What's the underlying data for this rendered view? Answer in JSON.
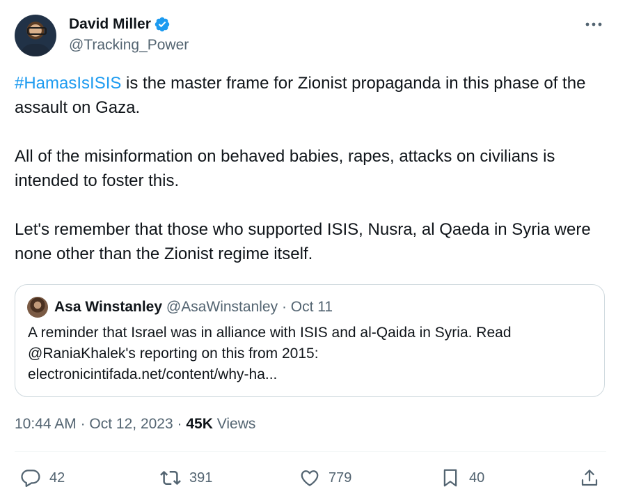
{
  "author": {
    "display_name": "David Miller",
    "handle": "@Tracking_Power",
    "verified": true,
    "avatar_icon": "profile-photo"
  },
  "tweet": {
    "hashtag": "#HamasIsISIS",
    "line1_rest": " is the master frame for Zionist propaganda in this phase of the assault on Gaza.",
    "para2": "All of the misinformation on behaved babies, rapes, attacks on civilians is intended to foster this.",
    "para3": "Let's remember that those who supported ISIS, Nusra, al Qaeda in Syria were none other than the Zionist regime itself."
  },
  "quote": {
    "display_name": "Asa Winstanley",
    "handle": "@AsaWinstanley",
    "separator": "·",
    "date": "Oct 11",
    "line1": "A reminder that Israel was in alliance with ISIS and al-Qaida in Syria. Read",
    "line2": "@RaniaKhalek's reporting on this from 2015:",
    "line3": "electronicintifada.net/content/why-ha..."
  },
  "meta": {
    "time": "10:44 AM",
    "dot": "·",
    "date": "Oct 12, 2023",
    "views_count": "45K",
    "views_label": " Views"
  },
  "actions": {
    "replies": "42",
    "retweets": "391",
    "likes": "779",
    "bookmarks": "40"
  },
  "colors": {
    "accent": "#1d9bf0",
    "text": "#0f1419",
    "secondary": "#536471",
    "border": "#cfd9de"
  }
}
